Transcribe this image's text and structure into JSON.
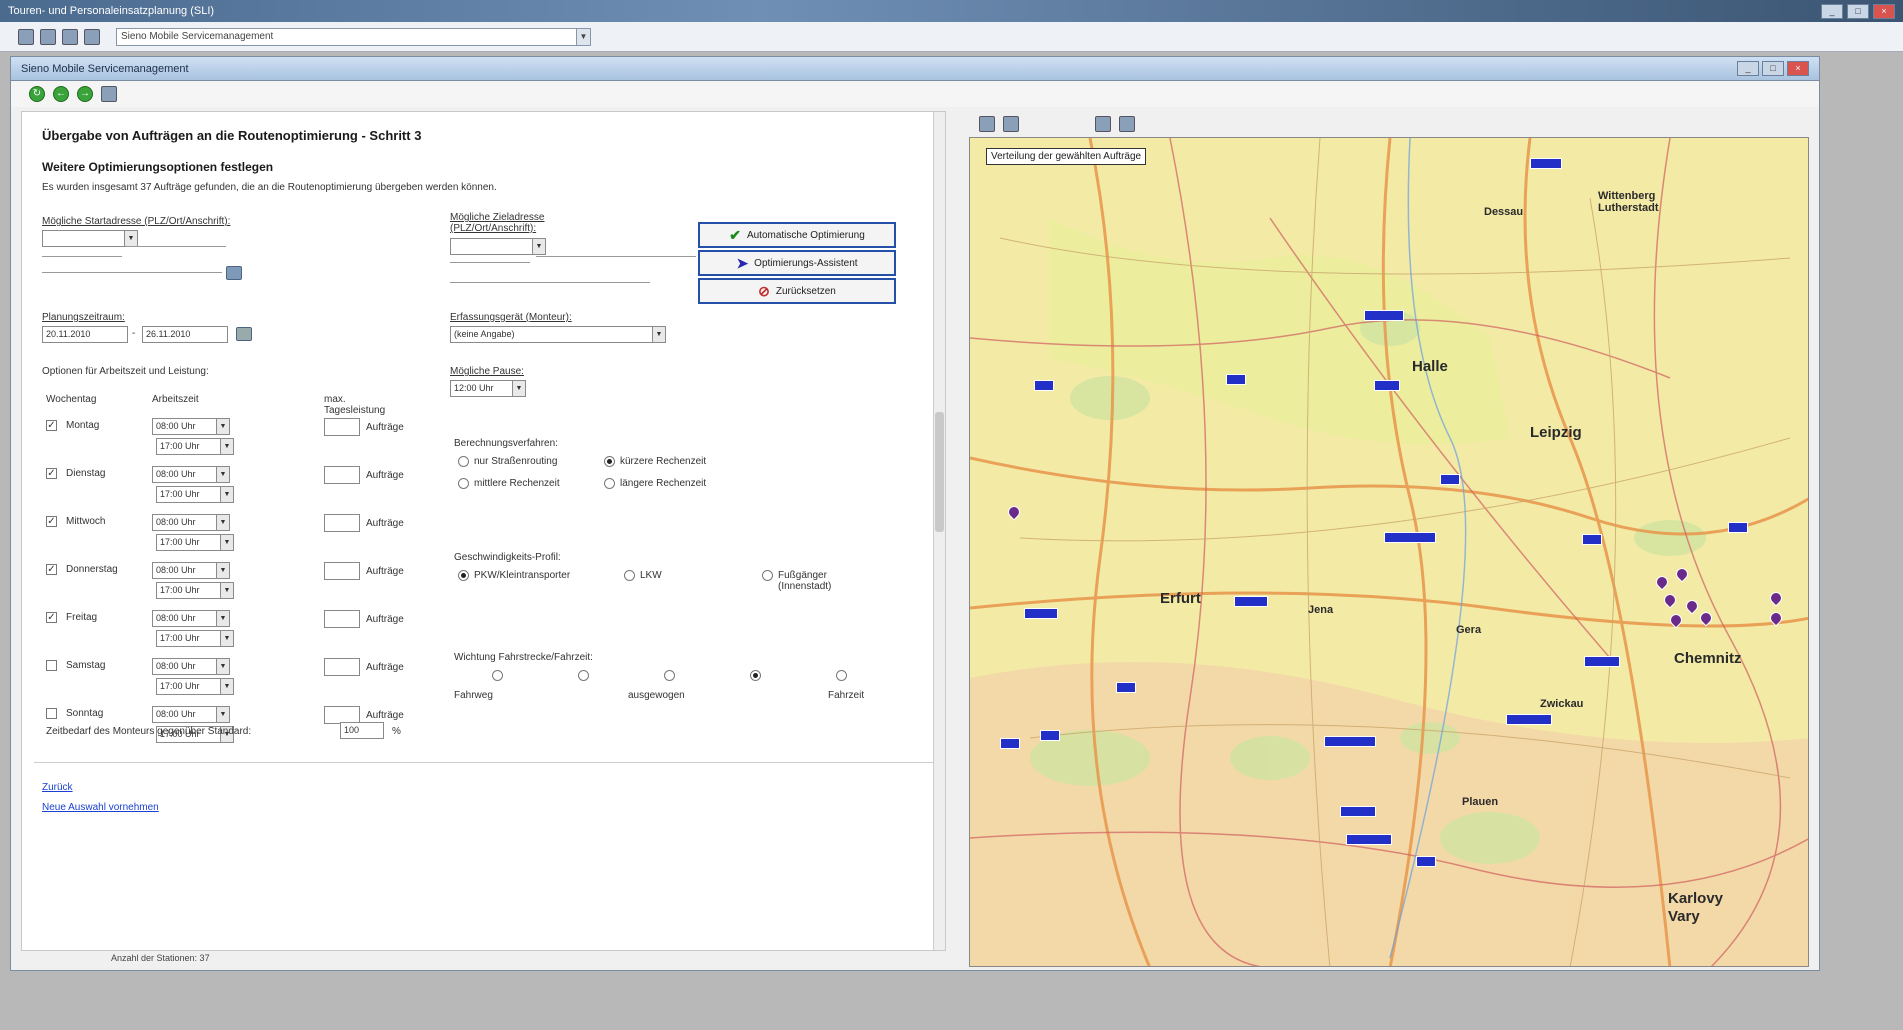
{
  "outer": {
    "title": "Touren- und Personaleinsatzplanung (SLI)",
    "combo_value": "Sieno Mobile Servicemanagement"
  },
  "inner": {
    "title": "Sieno Mobile Servicemanagement"
  },
  "form": {
    "heading": "Übergabe von Aufträgen an die Routenoptimierung - Schritt 3",
    "subheading": "Weitere Optimierungsoptionen festlegen",
    "intro": "Es wurden insgesamt 37 Aufträge gefunden, die an die Routenoptimierung übergeben werden können.",
    "start_label": "Mögliche Startadresse (PLZ/Ort/Anschrift):",
    "end_label": "Mögliche Zieladresse (PLZ/Ort/Anschrift):",
    "planning_label": "Planungszeitraum:",
    "date_from": "20.11.2010",
    "date_sep": "-",
    "date_to": "26.11.2010",
    "vehicle_label": "Erfassungsgerät (Monteur):",
    "vehicle_value": "(keine Angabe)",
    "pause_label": "Mögliche Pause:",
    "pause_value": "12:00 Uhr",
    "options_label": "Optionen für Arbeitszeit und Leistung:",
    "col_weekday": "Wochentag",
    "col_worktime": "Arbeitszeit",
    "col_max": "max. Tagesleistung",
    "orders_suffix": "Aufträge",
    "days": [
      {
        "name": "Montag",
        "checked": "✓",
        "start": "08:00 Uhr",
        "end": "17:00 Uhr"
      },
      {
        "name": "Dienstag",
        "checked": "✓",
        "start": "08:00 Uhr",
        "end": "17:00 Uhr"
      },
      {
        "name": "Mittwoch",
        "checked": "✓",
        "start": "08:00 Uhr",
        "end": "17:00 Uhr"
      },
      {
        "name": "Donnerstag",
        "checked": "✓",
        "start": "08:00 Uhr",
        "end": "17:00 Uhr"
      },
      {
        "name": "Freitag",
        "checked": "✓",
        "start": "08:00 Uhr",
        "end": "17:00 Uhr"
      },
      {
        "name": "Samstag",
        "checked": "",
        "start": "08:00 Uhr",
        "end": "17:00 Uhr"
      },
      {
        "name": "Sonntag",
        "checked": "",
        "start": "08:00 Uhr",
        "end": "17:00 Uhr"
      }
    ],
    "calc_label": "Berechnungsverfahren:",
    "calc_options": [
      "nur Straßenrouting",
      "kürzere Rechenzeit",
      "mittlere Rechenzeit",
      "längere Rechenzeit"
    ],
    "speed_label": "Geschwindigkeits-Profil:",
    "speed_options": [
      "PKW/Kleintransporter",
      "LKW",
      "Fußgänger (Innenstadt)"
    ],
    "weight_label": "Wichtung Fahrstrecke/Fahrzeit:",
    "weight_left": "Fahrweg",
    "weight_mid": "ausgewogen",
    "weight_right": "Fahrzeit",
    "mount_label": "Zeitbedarf des Monteurs gegenüber Standard:",
    "mount_value": "100",
    "mount_unit": "%",
    "btn_auto": "Automatische Optimierung",
    "btn_assist": "Optimierungs-Assistent",
    "btn_reset": "Zurücksetzen",
    "link_back": "Zurück",
    "link_new": "Neue Auswahl vornehmen",
    "status": "Anzahl der Stationen: 37"
  },
  "map": {
    "title": "Verteilung der gewählten Aufträge",
    "cities": [
      {
        "name": "Halle",
        "size": "big"
      },
      {
        "name": "Leipzig",
        "size": "big"
      },
      {
        "name": "Erfurt",
        "size": "big"
      },
      {
        "name": "Chemnitz",
        "size": "big"
      },
      {
        "name": "Karlovy Vary",
        "size": "big"
      },
      {
        "name": "Dessau",
        "size": "sm"
      },
      {
        "name": "Wittenberg Lutherstadt",
        "size": "sm"
      },
      {
        "name": "Jena",
        "size": "sm"
      },
      {
        "name": "Gera",
        "size": "sm"
      },
      {
        "name": "Plauen",
        "size": "sm"
      },
      {
        "name": "Zwickau",
        "size": "sm"
      }
    ]
  },
  "icons": [
    "app-icon",
    "back-icon",
    "print-icon",
    "help-icon",
    "refresh-icon",
    "zoom-in-icon",
    "zoom-out-icon",
    "calendar-icon",
    "search-icon",
    "check-icon",
    "arrow-icon",
    "reset-icon"
  ],
  "colors": {
    "accent": "#2450a8",
    "road_badge": "#2230c8",
    "pin": "#6a2a8a",
    "map_bg": "#f3eaa6"
  }
}
